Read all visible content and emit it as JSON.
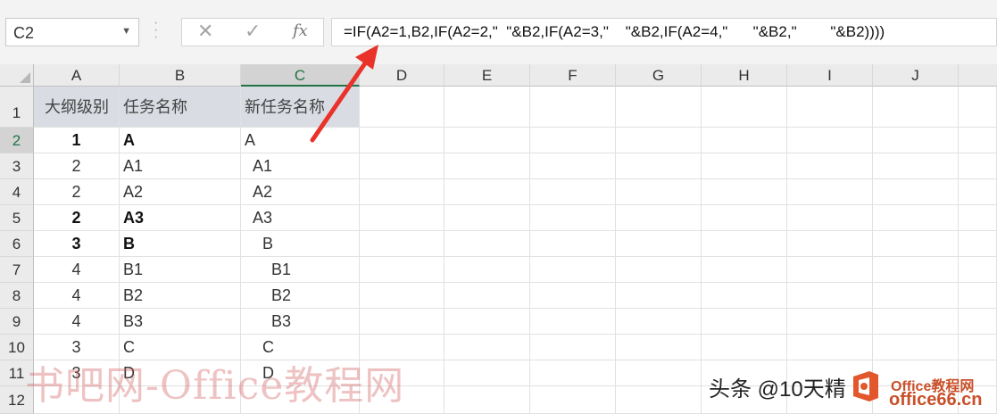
{
  "name_box": {
    "value": "C2"
  },
  "formula_bar": {
    "cancel_icon": "close-icon",
    "enter_icon": "checkmark-icon",
    "function_label": "fx",
    "formula": "=IF(A2=1,B2,IF(A2=2,\"  \"&B2,IF(A2=3,\"    \"&B2,IF(A2=4,\"      \"&B2,\"        \"&B2))))"
  },
  "columns": [
    "A",
    "B",
    "C",
    "D",
    "E",
    "F",
    "G",
    "H",
    "I",
    "J"
  ],
  "active_column": "C",
  "active_row": "2",
  "sheet": {
    "header": {
      "a": "大纲级别",
      "b": "任务名称",
      "c": "新任务名称"
    },
    "rows": [
      {
        "row": "1"
      },
      {
        "row": "2",
        "a": "1",
        "b": "A",
        "c": "A",
        "bold": true
      },
      {
        "row": "3",
        "a": "2",
        "b": "A1",
        "c": "  A1",
        "bold": false
      },
      {
        "row": "4",
        "a": "2",
        "b": "A2",
        "c": "  A2",
        "bold": false
      },
      {
        "row": "5",
        "a": "2",
        "b": "A3",
        "c": "  A3",
        "bold": true
      },
      {
        "row": "6",
        "a": "3",
        "b": "B",
        "c": "    B",
        "bold": true
      },
      {
        "row": "7",
        "a": "4",
        "b": "B1",
        "c": "      B1",
        "bold": false
      },
      {
        "row": "8",
        "a": "4",
        "b": "B2",
        "c": "      B2",
        "bold": false
      },
      {
        "row": "9",
        "a": "4",
        "b": "B3",
        "c": "      B3",
        "bold": false
      },
      {
        "row": "10",
        "a": "3",
        "b": "C",
        "c": "    C",
        "bold": false
      },
      {
        "row": "11",
        "a": "3",
        "b": "D",
        "c": "    D",
        "bold": false
      },
      {
        "row": "12"
      }
    ]
  },
  "watermarks": {
    "left": "书吧网-Office教程网",
    "author": "头条 @10天精",
    "site_top": "Office教程网",
    "site_bottom": "office66.cn"
  },
  "colors": {
    "accent": "#217346",
    "arrow": "#e8322a",
    "header_fill": "#d9dde3"
  }
}
